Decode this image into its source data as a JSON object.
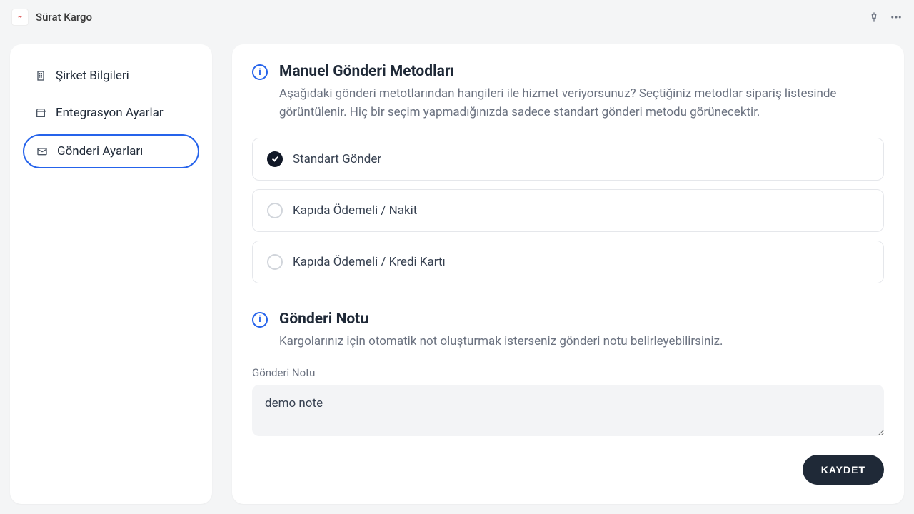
{
  "header": {
    "title": "Sürat Kargo"
  },
  "sidebar": {
    "items": [
      {
        "label": "Şirket Bilgileri"
      },
      {
        "label": "Entegrasyon Ayarlar"
      },
      {
        "label": "Gönderi Ayarları"
      }
    ]
  },
  "section1": {
    "title": "Manuel Gönderi Metodları",
    "desc": "Aşağıdaki gönderi metotlarından hangileri ile hizmet veriyorsunuz? Seçtiğiniz metodlar sipariş listesinde görüntülenir. Hiç bir seçim yapmadığınızda sadece standart gönderi metodu görünecektir.",
    "options": [
      {
        "label": "Standart Gönder",
        "checked": true
      },
      {
        "label": "Kapıda Ödemeli / Nakit",
        "checked": false
      },
      {
        "label": "Kapıda Ödemeli / Kredi Kartı",
        "checked": false
      }
    ]
  },
  "section2": {
    "title": "Gönderi Notu",
    "desc": "Kargolarınız için otomatik not oluşturmak isterseniz gönderi notu belirleyebilirsiniz.",
    "input_label": "Gönderi Notu",
    "input_value": "demo note"
  },
  "save_label": "KAYDET"
}
